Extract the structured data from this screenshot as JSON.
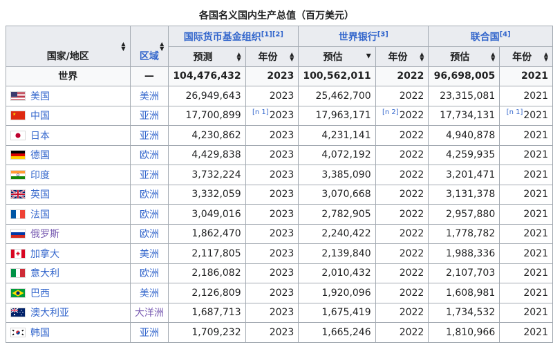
{
  "caption": "各国名义国内生产总值（百万美元）",
  "headers": {
    "country": "国家/地区",
    "region": "区域",
    "imf": "国际货币基金组织",
    "imf_refs": "[1][2]",
    "wb": "世界银行",
    "wb_refs": "[3]",
    "un": "联合国",
    "un_refs": "[4]",
    "forecast": "预测",
    "estimate1": "预估",
    "estimate2": "预估",
    "year1": "年份",
    "year2": "年份",
    "year3": "年份"
  },
  "world": {
    "name": "世界",
    "region": "—",
    "imf": "104,476,432",
    "imf_year": "2023",
    "wb": "100,562,011",
    "wb_year": "2022",
    "un": "96,698,005",
    "un_year": "2021"
  },
  "rows": [
    {
      "name": "美国",
      "region": "美洲",
      "imf": "26,949,643",
      "imf_note": "",
      "imf_year": "2023",
      "wb": "25,462,700",
      "wb_note": "",
      "wb_year": "2022",
      "un": "23,315,081",
      "un_note": "",
      "un_year": "2021",
      "flag": "us"
    },
    {
      "name": "中国",
      "region": "亚洲",
      "imf": "17,700,899",
      "imf_note": "[n 1]",
      "imf_year": "2023",
      "wb": "17,963,171",
      "wb_note": "[n 2]",
      "wb_year": "2022",
      "un": "17,734,131",
      "un_note": "[n 1]",
      "un_year": "2021",
      "flag": "cn"
    },
    {
      "name": "日本",
      "region": "亚洲",
      "imf": "4,230,862",
      "imf_note": "",
      "imf_year": "2023",
      "wb": "4,231,141",
      "wb_note": "",
      "wb_year": "2022",
      "un": "4,940,878",
      "un_note": "",
      "un_year": "2021",
      "flag": "jp"
    },
    {
      "name": "德国",
      "region": "欧洲",
      "imf": "4,429,838",
      "imf_note": "",
      "imf_year": "2023",
      "wb": "4,072,192",
      "wb_note": "",
      "wb_year": "2022",
      "un": "4,259,935",
      "un_note": "",
      "un_year": "2021",
      "flag": "de"
    },
    {
      "name": "印度",
      "region": "亚洲",
      "imf": "3,732,224",
      "imf_note": "",
      "imf_year": "2023",
      "wb": "3,385,090",
      "wb_note": "",
      "wb_year": "2022",
      "un": "3,201,471",
      "un_note": "",
      "un_year": "2021",
      "flag": "in"
    },
    {
      "name": "英国",
      "region": "欧洲",
      "imf": "3,332,059",
      "imf_note": "",
      "imf_year": "2023",
      "wb": "3,070,668",
      "wb_note": "",
      "wb_year": "2022",
      "un": "3,131,378",
      "un_note": "",
      "un_year": "2021",
      "flag": "gb"
    },
    {
      "name": "法国",
      "region": "欧洲",
      "imf": "3,049,016",
      "imf_note": "",
      "imf_year": "2023",
      "wb": "2,782,905",
      "wb_note": "",
      "wb_year": "2022",
      "un": "2,957,880",
      "un_note": "",
      "un_year": "2021",
      "flag": "fr"
    },
    {
      "name": "俄罗斯",
      "region": "欧洲",
      "imf": "1,862,470",
      "imf_note": "",
      "imf_year": "2023",
      "wb": "2,240,422",
      "wb_note": "",
      "wb_year": "2022",
      "un": "1,778,782",
      "un_note": "",
      "un_year": "2021",
      "flag": "ru"
    },
    {
      "name": "加拿大",
      "region": "美洲",
      "imf": "2,117,805",
      "imf_note": "",
      "imf_year": "2023",
      "wb": "2,139,840",
      "wb_note": "",
      "wb_year": "2022",
      "un": "1,988,336",
      "un_note": "",
      "un_year": "2021",
      "flag": "ca"
    },
    {
      "name": "意大利",
      "region": "欧洲",
      "imf": "2,186,082",
      "imf_note": "",
      "imf_year": "2023",
      "wb": "2,010,432",
      "wb_note": "",
      "wb_year": "2022",
      "un": "2,107,703",
      "un_note": "",
      "un_year": "2021",
      "flag": "it"
    },
    {
      "name": "巴西",
      "region": "美洲",
      "imf": "2,126,809",
      "imf_note": "",
      "imf_year": "2023",
      "wb": "1,920,096",
      "wb_note": "",
      "wb_year": "2022",
      "un": "1,608,981",
      "un_note": "",
      "un_year": "2021",
      "flag": "br"
    },
    {
      "name": "澳大利亚",
      "region": "大洋洲",
      "imf": "1,687,713",
      "imf_note": "",
      "imf_year": "2023",
      "wb": "1,675,419",
      "wb_note": "",
      "wb_year": "2022",
      "un": "1,734,532",
      "un_note": "",
      "un_year": "2021",
      "flag": "au"
    },
    {
      "name": "韩国",
      "region": "亚洲",
      "imf": "1,709,232",
      "imf_note": "",
      "imf_year": "2023",
      "wb": "1,665,246",
      "wb_note": "",
      "wb_year": "2022",
      "un": "1,810,966",
      "un_note": "",
      "un_year": "2021",
      "flag": "kr"
    }
  ],
  "colors": {
    "link": "#3366cc",
    "visited": "#795cb2",
    "header_bg": "#eaecf0",
    "border": "#a2a9b1"
  }
}
